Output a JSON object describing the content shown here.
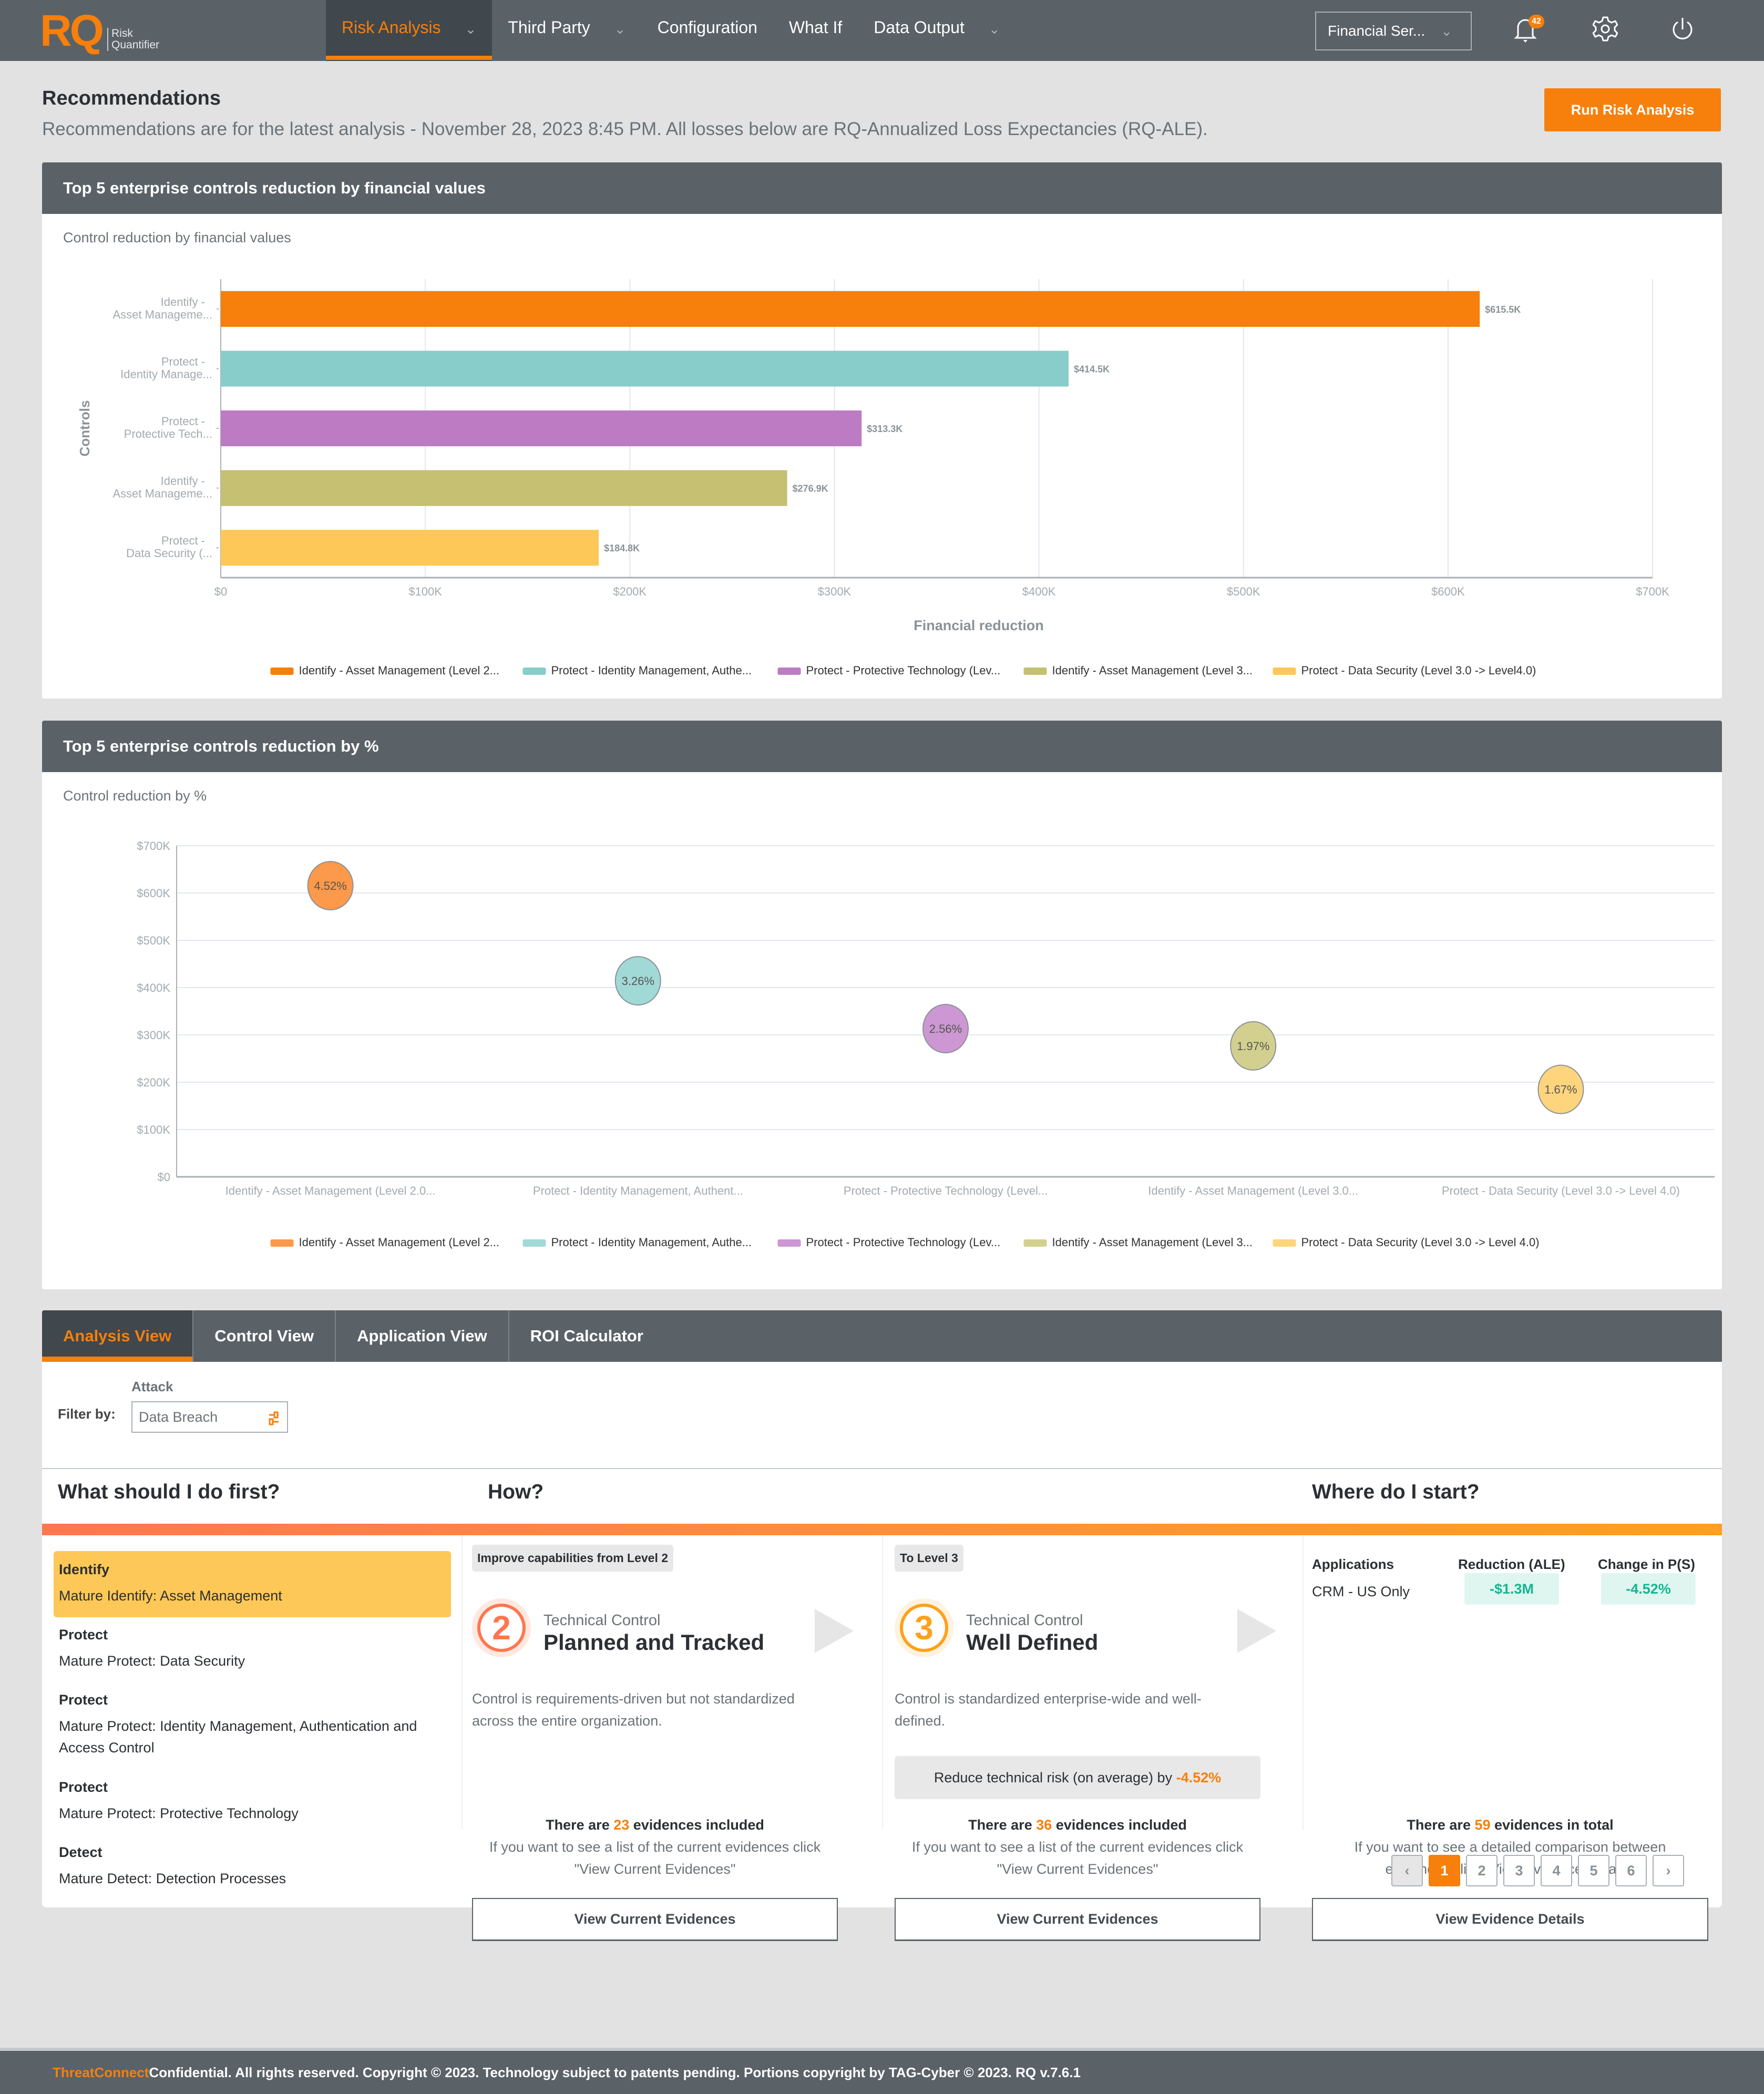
{
  "brand": {
    "logo": "RQ",
    "sub_line1": "Risk",
    "sub_line2": "Quantifier",
    "accent": "#f77f0b"
  },
  "nav": {
    "items": [
      {
        "label": "Risk Analysis",
        "active": true,
        "dropdown": true
      },
      {
        "label": "Third Party",
        "dropdown": true
      },
      {
        "label": "Configuration"
      },
      {
        "label": "What If"
      },
      {
        "label": "Data Output",
        "dropdown": true
      }
    ],
    "org_select": "Financial Ser...",
    "notifications_count": "42",
    "icons": [
      "bell-icon",
      "gear-icon",
      "power-icon"
    ]
  },
  "page": {
    "title": "Recommendations",
    "subtitle": "Recommendations are for the latest analysis - November 28, 2023 8:45 PM. All losses below are RQ-Annualized Loss Expectancies (RQ-ALE).",
    "run_button": "Run Risk Analysis"
  },
  "card1": {
    "header": "Top 5 enterprise controls reduction by financial values",
    "subtitle": "Control reduction by financial values"
  },
  "card2": {
    "header": "Top 5 enterprise controls reduction by %",
    "subtitle": "Control reduction by %"
  },
  "chart_data": [
    {
      "type": "bar",
      "orientation": "horizontal",
      "title": "Control reduction by financial values",
      "xlabel": "Financial reduction",
      "ylabel": "Controls",
      "xlim": [
        0,
        700000
      ],
      "x_ticks": [
        "$0",
        "$100K",
        "$200K",
        "$300K",
        "$400K",
        "$500K",
        "$600K",
        "$700K"
      ],
      "grid": true,
      "legend_position": "bottom",
      "categories": [
        [
          "Identify -",
          "Asset Manageme..."
        ],
        [
          "Protect -",
          "Identity Manage..."
        ],
        [
          "Protect -",
          "Protective Tech..."
        ],
        [
          "Identify -",
          "Asset Manageme..."
        ],
        [
          "Protect -",
          "Data Security (..."
        ]
      ],
      "values": [
        615500,
        414500,
        313300,
        276900,
        184800
      ],
      "data_labels": [
        "$615.5K",
        "$414.5K",
        "$313.3K",
        "$276.9K",
        "$184.8K"
      ],
      "colors": [
        "#f77f0b",
        "#88cdc9",
        "#bd7bc4",
        "#c5c072",
        "#fdc857"
      ],
      "legend": [
        "Identify - Asset Management (Level 2...",
        "Protect - Identity Management, Authe...",
        "Protect - Protective Technology (Lev...",
        "Identify - Asset Management (Level 3...",
        "Protect - Data Security (Level 3.0 -> Level4.0)"
      ]
    },
    {
      "type": "scatter",
      "subtype": "bubble",
      "title": "Control reduction by %",
      "ylim": [
        0,
        700000
      ],
      "y_ticks": [
        "$0",
        "$100K",
        "$200K",
        "$300K",
        "$400K",
        "$500K",
        "$600K",
        "$700K"
      ],
      "grid": true,
      "legend_position": "bottom",
      "categories": [
        "Identify - Asset Management (Level 2.0...",
        "Protect - Identity Management, Authent...",
        "Protect - Protective Technology (Level...",
        "Identify - Asset Management (Level 3.0...",
        "Protect - Data Security (Level 3.0 -> Level 4.0)"
      ],
      "values": [
        615500,
        414500,
        313300,
        276900,
        184800
      ],
      "bubble_labels": [
        "4.52%",
        "3.26%",
        "2.56%",
        "1.97%",
        "1.67%"
      ],
      "colors": [
        "#fc994a",
        "#a1d9d6",
        "#cc97d2",
        "#d3d08f",
        "#fed57c"
      ],
      "legend": [
        "Identify - Asset Management (Level 2...",
        "Protect - Identity Management, Authe...",
        "Protect - Protective Technology (Lev...",
        "Identify - Asset Management (Level 3...",
        "Protect - Data Security (Level 3.0 -> Level 4.0)"
      ]
    }
  ],
  "analysis": {
    "tabs": [
      "Analysis View",
      "Control View",
      "Application View",
      "ROI Calculator"
    ],
    "active_tab": "Analysis View",
    "filter": {
      "label": "Filter by:",
      "field_label": "Attack",
      "value": "Data Breach"
    },
    "columns": {
      "first": "What should I do first?",
      "how": "How?",
      "where": "Where do I start?"
    },
    "controls": [
      {
        "category": "Identify",
        "name": "Mature Identify: Asset Management",
        "selected": true
      },
      {
        "category": "Protect",
        "name": "Mature Protect: Data Security"
      },
      {
        "category": "Protect",
        "name": "Mature Protect: Identity Management, Authentication and Access Control"
      },
      {
        "category": "Protect",
        "name": "Mature Protect: Protective Technology"
      },
      {
        "category": "Detect",
        "name": "Mature Detect: Detection Processes"
      }
    ],
    "current_level": {
      "pill": "Improve capabilities from Level 2",
      "number": "2",
      "sub": "Technical Control",
      "name": "Planned and Tracked",
      "desc": "Control is requirements-driven but not standardized across the entire organization.",
      "evid_pre": "There are ",
      "evid_count": "23",
      "evid_post": " evidences included",
      "help": "If you want to see a list of the current evidences click \"View Current Evidences\"",
      "button": "View Current Evidences"
    },
    "target_level": {
      "pill": "To Level 3",
      "number": "3",
      "sub": "Technical Control",
      "name": "Well Defined",
      "desc": "Control is standardized enterprise-wide and well-defined.",
      "risk_pre": "Reduce technical risk (on average) by ",
      "risk_value": "-4.52%",
      "evid_pre": "There are ",
      "evid_count": "36",
      "evid_post": " evidences included",
      "help": "If you want to see a list of the current evidences click \"View Current Evidences\"",
      "button": "View Current Evidences"
    },
    "apps": {
      "headers": [
        "Applications",
        "Reduction (ALE)",
        "Change in P(S)"
      ],
      "rows": [
        {
          "name": "CRM - US Only",
          "reduction": "-$1.3M",
          "change": "-4.52%"
        }
      ],
      "evid_pre": "There are ",
      "evid_count": "59",
      "evid_post": " evidences in total",
      "help": "If you want to see a detailed comparison between evidences click \"View Evidence Details\"",
      "button": "View Evidence Details"
    },
    "pagination": {
      "prev": "‹",
      "pages": [
        "1",
        "2",
        "3",
        "4",
        "5",
        "6"
      ],
      "current": "1",
      "next": "›"
    }
  },
  "footer": {
    "brand": "ThreatConnect",
    "text": " Confidential. All rights reserved. Copyright © 2023. Technology subject to patents pending. Portions copyright by TAG-Cyber © 2023. RQ v.7.6.1"
  }
}
